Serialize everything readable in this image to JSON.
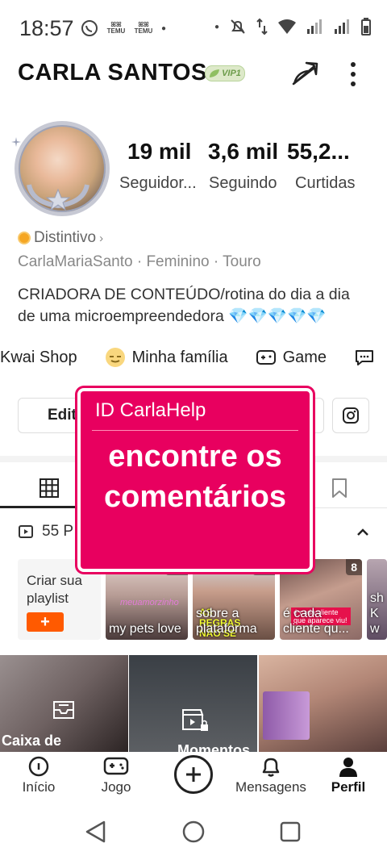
{
  "status": {
    "time": "18:57",
    "temu1": "TEMU",
    "temu2": "TEMU"
  },
  "header": {
    "name": "CARLA  SANTOS",
    "vip": "VIP1"
  },
  "stats": [
    {
      "value": "19 mil",
      "label": "Seguidor..."
    },
    {
      "value": "3,6 mil",
      "label": "Seguindo"
    },
    {
      "value": "55,2...",
      "label": "Curtidas"
    }
  ],
  "profile": {
    "distintivo": "Distintivo",
    "meta": "CarlaMariaSanto · Feminino · Touro",
    "bio_line1": "CRIADORA DE CONTEÚDO/rotina do dia a dia",
    "bio_line2": "de uma microempreendedora",
    "bio_emoji": "💎💎💎💎💎"
  },
  "tags": [
    {
      "label": "Kwai Shop",
      "icon": "shop-icon"
    },
    {
      "label": "Minha família",
      "icon": "family-emoji-icon"
    },
    {
      "label": "Game",
      "icon": "gamepad-icon"
    },
    {
      "label": "",
      "icon": "chat-icon"
    }
  ],
  "buttons": {
    "edit": "Edit",
    "other_suffix": "s"
  },
  "works": {
    "label": "55 P"
  },
  "playlist": {
    "create_line1": "Criar sua",
    "create_line2": "playlist",
    "plus": "+"
  },
  "thumbs": [
    {
      "count": "42",
      "caption": "my pets love",
      "overlay": "meuamorzinho"
    },
    {
      "count": "20",
      "caption": "sobre a plataforma",
      "overlay": "AS REGRAS NÃO SE"
    },
    {
      "count": "8",
      "caption": "é cada cliente qu...",
      "overlay": "é cada cliente que aparece viu!"
    },
    {
      "count": "",
      "caption": "sh Kw",
      "overlay": ""
    }
  ],
  "grid": [
    {
      "label": "Caixa de"
    },
    {
      "label": "Momentos"
    },
    {
      "label": ""
    }
  ],
  "overlay": {
    "id": "ID  CarlaHelp",
    "main_line1": "encontre os",
    "main_line2": "comentários"
  },
  "bottomnav": [
    {
      "label": "Início",
      "icon": "home-icon"
    },
    {
      "label": "Jogo",
      "icon": "gamepad-icon"
    },
    {
      "label": "",
      "icon": "plus-icon"
    },
    {
      "label": "Mensagens",
      "icon": "bell-icon"
    },
    {
      "label": "Perfil",
      "icon": "person-icon"
    }
  ],
  "colors": {
    "accent": "#ff5a00",
    "overlay": "#e8005f",
    "vip": "#6d9c4b"
  }
}
